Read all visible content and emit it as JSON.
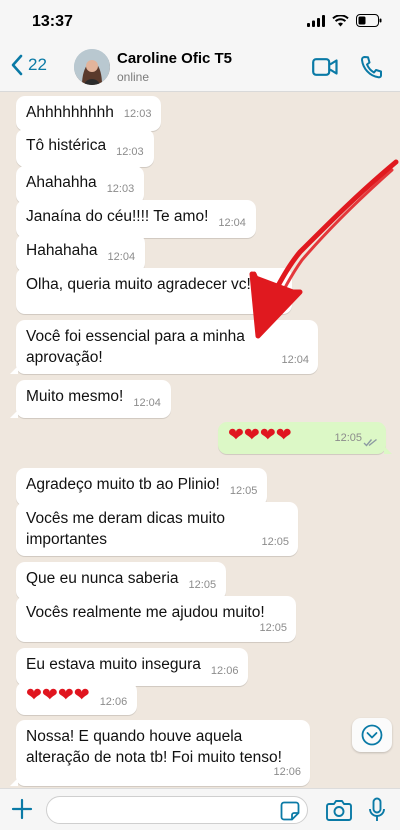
{
  "status_bar": {
    "time": "13:37"
  },
  "header": {
    "back_count": "22",
    "contact_name": "Caroline Ofic T5",
    "contact_status": "online"
  },
  "messages": [
    {
      "dir": "in",
      "text": "Ahhhhhhhhh",
      "time": "12:03"
    },
    {
      "dir": "in",
      "text": "Tô histérica",
      "time": "12:03"
    },
    {
      "dir": "in",
      "text": "Ahahahha",
      "time": "12:03"
    },
    {
      "dir": "in",
      "text": "Janaína do céu!!!! Te amo!",
      "time": "12:04"
    },
    {
      "dir": "in",
      "text": "Hahahaha",
      "time": "12:04"
    },
    {
      "dir": "in",
      "text": "Olha, queria muito agradecer vc!",
      "time": "12:04"
    },
    {
      "dir": "in",
      "text": "Você foi essencial para a minha aprovação!",
      "time": "12:04"
    },
    {
      "dir": "in",
      "text": "Muito mesmo!",
      "time": "12:04"
    },
    {
      "dir": "out",
      "text": "❤❤❤❤",
      "time": "12:05"
    },
    {
      "dir": "in",
      "text": "Agradeço muito tb ao Plinio!",
      "time": "12:05"
    },
    {
      "dir": "in",
      "text": "Vocês me deram dicas muito importantes",
      "time": "12:05"
    },
    {
      "dir": "in",
      "text": "Que eu nunca saberia",
      "time": "12:05"
    },
    {
      "dir": "in",
      "text": "Vocês realmente me ajudou muito!",
      "time": "12:05"
    },
    {
      "dir": "in",
      "text": "Eu estava muito insegura",
      "time": "12:06"
    },
    {
      "dir": "in",
      "text": "❤❤❤❤",
      "time": "12:06"
    },
    {
      "dir": "in",
      "text": "Nossa! E quando houve aquela alteração de nota tb! Foi muito tenso!",
      "time": "12:06"
    }
  ],
  "input": {
    "placeholder": "",
    "value": ""
  },
  "colors": {
    "accent": "#0a7aa6",
    "outgoing": "#dcf8c6",
    "incoming": "#ffffff",
    "annotation_arrow": "#e0191f",
    "heart": "#e0151f"
  },
  "icons": [
    "back-chevron-icon",
    "video-call-icon",
    "phone-icon",
    "chevron-down-icon",
    "plus-icon",
    "sticker-icon",
    "camera-icon",
    "microphone-icon",
    "double-check-icon"
  ]
}
